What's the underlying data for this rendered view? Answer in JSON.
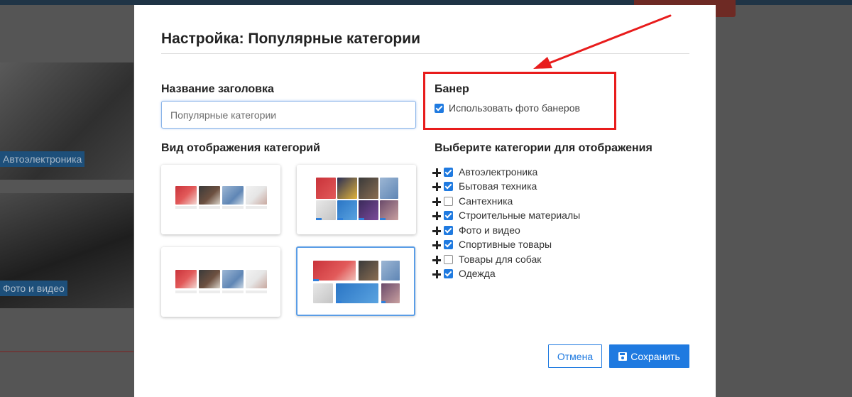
{
  "background": {
    "category_labels": [
      "Автоэлектроника",
      "Фото и видео"
    ]
  },
  "modal": {
    "title": "Настройка: Популярные категории",
    "heading_section": {
      "label": "Название заголовка",
      "input_value": "",
      "input_placeholder": "Популярные категории"
    },
    "banner_section": {
      "label": "Банер",
      "option_label": "Использовать фото банеров",
      "option_checked": true
    },
    "display_section": {
      "label": "Вид отображения категорий",
      "layouts": [
        {
          "name": "layout-1",
          "selected": false
        },
        {
          "name": "layout-2",
          "selected": false
        },
        {
          "name": "layout-3",
          "selected": false
        },
        {
          "name": "layout-4",
          "selected": true
        }
      ]
    },
    "categories_section": {
      "label": "Выберите категории для отображения",
      "items": [
        {
          "label": "Автоэлектроника",
          "checked": true
        },
        {
          "label": "Бытовая техника",
          "checked": true
        },
        {
          "label": "Сантехника",
          "checked": false
        },
        {
          "label": "Строительные материалы",
          "checked": true
        },
        {
          "label": "Фото и видео",
          "checked": true
        },
        {
          "label": "Спортивные товары",
          "checked": true
        },
        {
          "label": "Товары для собак",
          "checked": false
        },
        {
          "label": "Одежда",
          "checked": true
        }
      ]
    },
    "buttons": {
      "cancel_label": "Отмена",
      "save_label": "Сохранить"
    }
  },
  "colors": {
    "accent": "#1f7ae0",
    "annotation": "#e81c1c",
    "selected_card_border": "#5a9de6"
  },
  "icons": {
    "save": "floppy-disk-icon",
    "expand": "plus-icon",
    "check": "checkbox-icon"
  }
}
